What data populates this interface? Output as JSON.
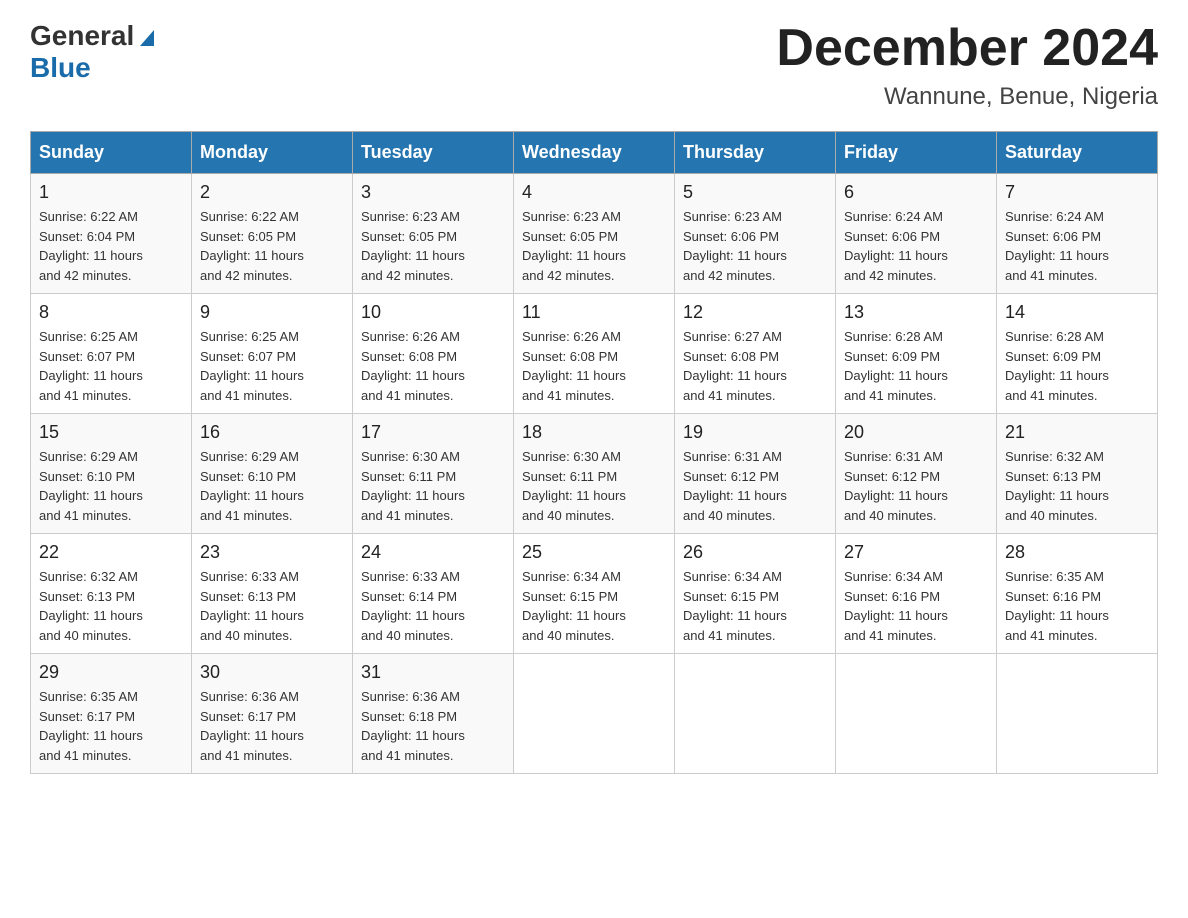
{
  "header": {
    "logo_general": "General",
    "logo_blue": "Blue",
    "month_title": "December 2024",
    "location": "Wannune, Benue, Nigeria"
  },
  "weekdays": [
    "Sunday",
    "Monday",
    "Tuesday",
    "Wednesday",
    "Thursday",
    "Friday",
    "Saturday"
  ],
  "weeks": [
    [
      {
        "day": "1",
        "sunrise": "6:22 AM",
        "sunset": "6:04 PM",
        "daylight": "11 hours and 42 minutes."
      },
      {
        "day": "2",
        "sunrise": "6:22 AM",
        "sunset": "6:05 PM",
        "daylight": "11 hours and 42 minutes."
      },
      {
        "day": "3",
        "sunrise": "6:23 AM",
        "sunset": "6:05 PM",
        "daylight": "11 hours and 42 minutes."
      },
      {
        "day": "4",
        "sunrise": "6:23 AM",
        "sunset": "6:05 PM",
        "daylight": "11 hours and 42 minutes."
      },
      {
        "day": "5",
        "sunrise": "6:23 AM",
        "sunset": "6:06 PM",
        "daylight": "11 hours and 42 minutes."
      },
      {
        "day": "6",
        "sunrise": "6:24 AM",
        "sunset": "6:06 PM",
        "daylight": "11 hours and 42 minutes."
      },
      {
        "day": "7",
        "sunrise": "6:24 AM",
        "sunset": "6:06 PM",
        "daylight": "11 hours and 41 minutes."
      }
    ],
    [
      {
        "day": "8",
        "sunrise": "6:25 AM",
        "sunset": "6:07 PM",
        "daylight": "11 hours and 41 minutes."
      },
      {
        "day": "9",
        "sunrise": "6:25 AM",
        "sunset": "6:07 PM",
        "daylight": "11 hours and 41 minutes."
      },
      {
        "day": "10",
        "sunrise": "6:26 AM",
        "sunset": "6:08 PM",
        "daylight": "11 hours and 41 minutes."
      },
      {
        "day": "11",
        "sunrise": "6:26 AM",
        "sunset": "6:08 PM",
        "daylight": "11 hours and 41 minutes."
      },
      {
        "day": "12",
        "sunrise": "6:27 AM",
        "sunset": "6:08 PM",
        "daylight": "11 hours and 41 minutes."
      },
      {
        "day": "13",
        "sunrise": "6:28 AM",
        "sunset": "6:09 PM",
        "daylight": "11 hours and 41 minutes."
      },
      {
        "day": "14",
        "sunrise": "6:28 AM",
        "sunset": "6:09 PM",
        "daylight": "11 hours and 41 minutes."
      }
    ],
    [
      {
        "day": "15",
        "sunrise": "6:29 AM",
        "sunset": "6:10 PM",
        "daylight": "11 hours and 41 minutes."
      },
      {
        "day": "16",
        "sunrise": "6:29 AM",
        "sunset": "6:10 PM",
        "daylight": "11 hours and 41 minutes."
      },
      {
        "day": "17",
        "sunrise": "6:30 AM",
        "sunset": "6:11 PM",
        "daylight": "11 hours and 41 minutes."
      },
      {
        "day": "18",
        "sunrise": "6:30 AM",
        "sunset": "6:11 PM",
        "daylight": "11 hours and 40 minutes."
      },
      {
        "day": "19",
        "sunrise": "6:31 AM",
        "sunset": "6:12 PM",
        "daylight": "11 hours and 40 minutes."
      },
      {
        "day": "20",
        "sunrise": "6:31 AM",
        "sunset": "6:12 PM",
        "daylight": "11 hours and 40 minutes."
      },
      {
        "day": "21",
        "sunrise": "6:32 AM",
        "sunset": "6:13 PM",
        "daylight": "11 hours and 40 minutes."
      }
    ],
    [
      {
        "day": "22",
        "sunrise": "6:32 AM",
        "sunset": "6:13 PM",
        "daylight": "11 hours and 40 minutes."
      },
      {
        "day": "23",
        "sunrise": "6:33 AM",
        "sunset": "6:13 PM",
        "daylight": "11 hours and 40 minutes."
      },
      {
        "day": "24",
        "sunrise": "6:33 AM",
        "sunset": "6:14 PM",
        "daylight": "11 hours and 40 minutes."
      },
      {
        "day": "25",
        "sunrise": "6:34 AM",
        "sunset": "6:15 PM",
        "daylight": "11 hours and 40 minutes."
      },
      {
        "day": "26",
        "sunrise": "6:34 AM",
        "sunset": "6:15 PM",
        "daylight": "11 hours and 41 minutes."
      },
      {
        "day": "27",
        "sunrise": "6:34 AM",
        "sunset": "6:16 PM",
        "daylight": "11 hours and 41 minutes."
      },
      {
        "day": "28",
        "sunrise": "6:35 AM",
        "sunset": "6:16 PM",
        "daylight": "11 hours and 41 minutes."
      }
    ],
    [
      {
        "day": "29",
        "sunrise": "6:35 AM",
        "sunset": "6:17 PM",
        "daylight": "11 hours and 41 minutes."
      },
      {
        "day": "30",
        "sunrise": "6:36 AM",
        "sunset": "6:17 PM",
        "daylight": "11 hours and 41 minutes."
      },
      {
        "day": "31",
        "sunrise": "6:36 AM",
        "sunset": "6:18 PM",
        "daylight": "11 hours and 41 minutes."
      },
      null,
      null,
      null,
      null
    ]
  ],
  "labels": {
    "sunrise": "Sunrise:",
    "sunset": "Sunset:",
    "daylight": "Daylight:"
  }
}
